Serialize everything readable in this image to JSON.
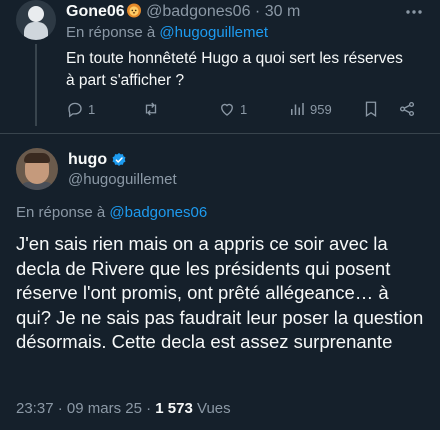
{
  "tweet1": {
    "display_name": "Gone06",
    "handle": "@badgones06",
    "separator": "·",
    "time": "30 m",
    "reply_prefix": "En réponse à",
    "reply_to": "@hugoguillemet",
    "text": "En toute honnêteté Hugo a quoi sert les réserves à part s'afficher ?",
    "replies": "1",
    "retweets": "",
    "likes": "1",
    "views": "959"
  },
  "tweet2": {
    "display_name": "hugo",
    "handle": "@hugoguillemet",
    "reply_prefix": "En réponse à",
    "reply_to": "@badgones06",
    "text": "J'en sais rien mais on a appris ce soir avec la decla de Rivere que les présidents qui posent réserve l'ont promis, ont prêté allégeance… à qui? Je ne sais pas faudrait leur poser la question désormais. Cette decla est assez surprenante",
    "time": "23:37",
    "date": "09 mars 25",
    "separator": "·",
    "views_count": "1 573",
    "views_label": "Vues"
  },
  "colors": {
    "background": "#15202b",
    "text": "#f7f9f9",
    "muted": "#8b98a5",
    "accent": "#1d9bf0",
    "divider": "#38444d"
  },
  "icons": [
    "more-icon",
    "reply-icon",
    "retweet-icon",
    "like-icon",
    "views-icon",
    "bookmark-icon",
    "share-icon",
    "verified-badge-icon",
    "lion-emoji-icon"
  ]
}
